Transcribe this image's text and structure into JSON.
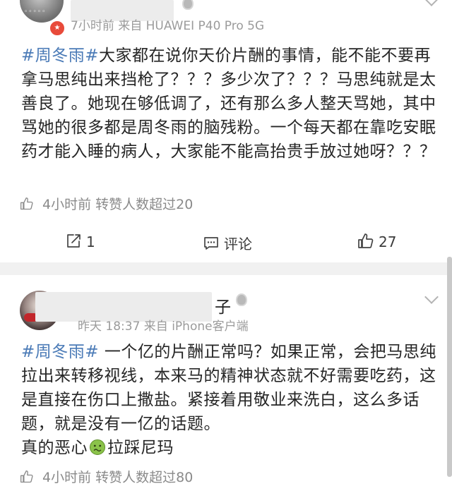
{
  "posts": [
    {
      "meta": "7小时前 来自 HUAWEI P40 Pro 5G",
      "hashtag": "#周冬雨#",
      "body": "大家都在说你天价片酬的事情，能不能不要再拿马思纯出来挡枪了？？？多少次了？？？马思纯就是太善良了。她现在够低调了，还有那么多人整天骂她，其中骂她的很多都是周冬雨的脑残粉。一个每天都在靠吃安眠药才能入睡的病人，大家能不能高抬贵手放过她呀？？？",
      "like_row": "4小时前 转赞人数超过20",
      "actions": {
        "repost": "1",
        "comment": "评论",
        "like": "27"
      }
    },
    {
      "name_tail": "子",
      "meta": "昨天 18:37 来自 iPhone客户端",
      "hashtag": "#周冬雨#",
      "body": " 一个亿的片酬正常吗？如果正常，会把马思纯拉出来转移视线，本来马的精神状态就不好需要吃药，这是直接在伤口上撒盐。紧接着用敬业来洗白，这么多话题，就是没有一亿的话题。",
      "body_line2_a": "真的恶心",
      "body_line2_b": "拉踩尼玛",
      "like_row": "4小时前 转赞人数超过80"
    }
  ],
  "icons": {
    "thumbs_up": "thumbs-up-icon",
    "repost": "repost-icon",
    "comment": "comment-icon",
    "emoji": "nauseated-face-emoji",
    "verified": "verified-badge-icon",
    "chevron": "chevron-down-icon"
  },
  "colors": {
    "hashtag": "#4b7bb7",
    "meta": "#9b9b9b",
    "badge": "#e84a3a"
  }
}
